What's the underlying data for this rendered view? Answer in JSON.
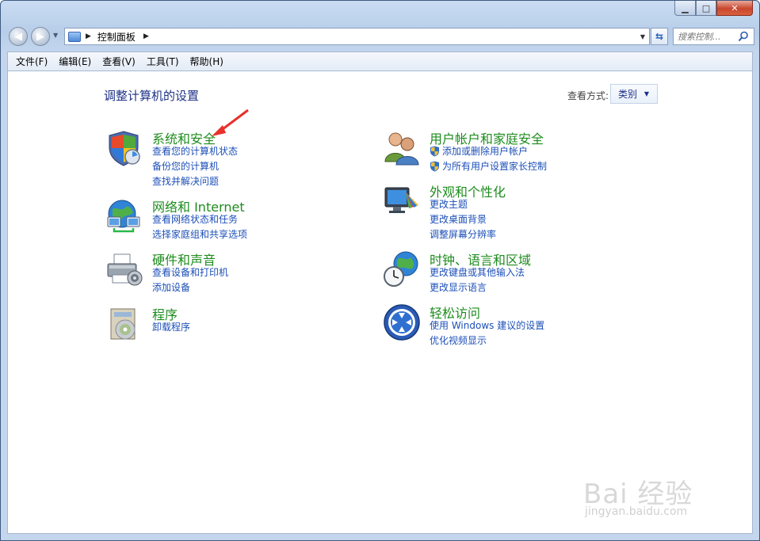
{
  "window": {
    "minimize_glyph": "▁",
    "maximize_glyph": "□",
    "close_glyph": "✕"
  },
  "address_bar": {
    "breadcrumb": "控制面板",
    "search_placeholder": "搜索控制..."
  },
  "menu": [
    "文件(F)",
    "编辑(E)",
    "查看(V)",
    "工具(T)",
    "帮助(H)"
  ],
  "header": {
    "title": "调整计算机的设置",
    "view_by_label": "查看方式:",
    "view_by_value": "类别"
  },
  "categories": {
    "system_security": {
      "title": "系统和安全",
      "icon": "shield-icon",
      "links": [
        "查看您的计算机状态",
        "备份您的计算机",
        "查找并解决问题"
      ]
    },
    "network": {
      "title": "网络和 Internet",
      "icon": "network-icon",
      "links": [
        "查看网络状态和任务",
        "选择家庭组和共享选项"
      ]
    },
    "hardware": {
      "title": "硬件和声音",
      "icon": "printer-icon",
      "links": [
        "查看设备和打印机",
        "添加设备"
      ]
    },
    "programs": {
      "title": "程序",
      "icon": "programs-icon",
      "links": [
        "卸载程序"
      ]
    },
    "user_accounts": {
      "title": "用户帐户和家庭安全",
      "icon": "users-icon",
      "links": [
        "添加或删除用户帐户",
        "为所有用户设置家长控制"
      ]
    },
    "appearance": {
      "title": "外观和个性化",
      "icon": "monitor-icon",
      "links": [
        "更改主题",
        "更改桌面背景",
        "调整屏幕分辨率"
      ]
    },
    "clock_region": {
      "title": "时钟、语言和区域",
      "icon": "clock-globe-icon",
      "links": [
        "更改键盘或其他输入法",
        "更改显示语言"
      ]
    },
    "ease_of_access": {
      "title": "轻松访问",
      "icon": "ease-of-access-icon",
      "links": [
        "使用 Windows 建议的设置",
        "优化视频显示"
      ]
    }
  },
  "watermark": {
    "brand": "Bai 经验",
    "url": "jingyan.baidu.com"
  },
  "colors": {
    "title_blue": "#1e3287",
    "category_green": "#1e8c1e",
    "link_blue": "#1c4fb8"
  }
}
